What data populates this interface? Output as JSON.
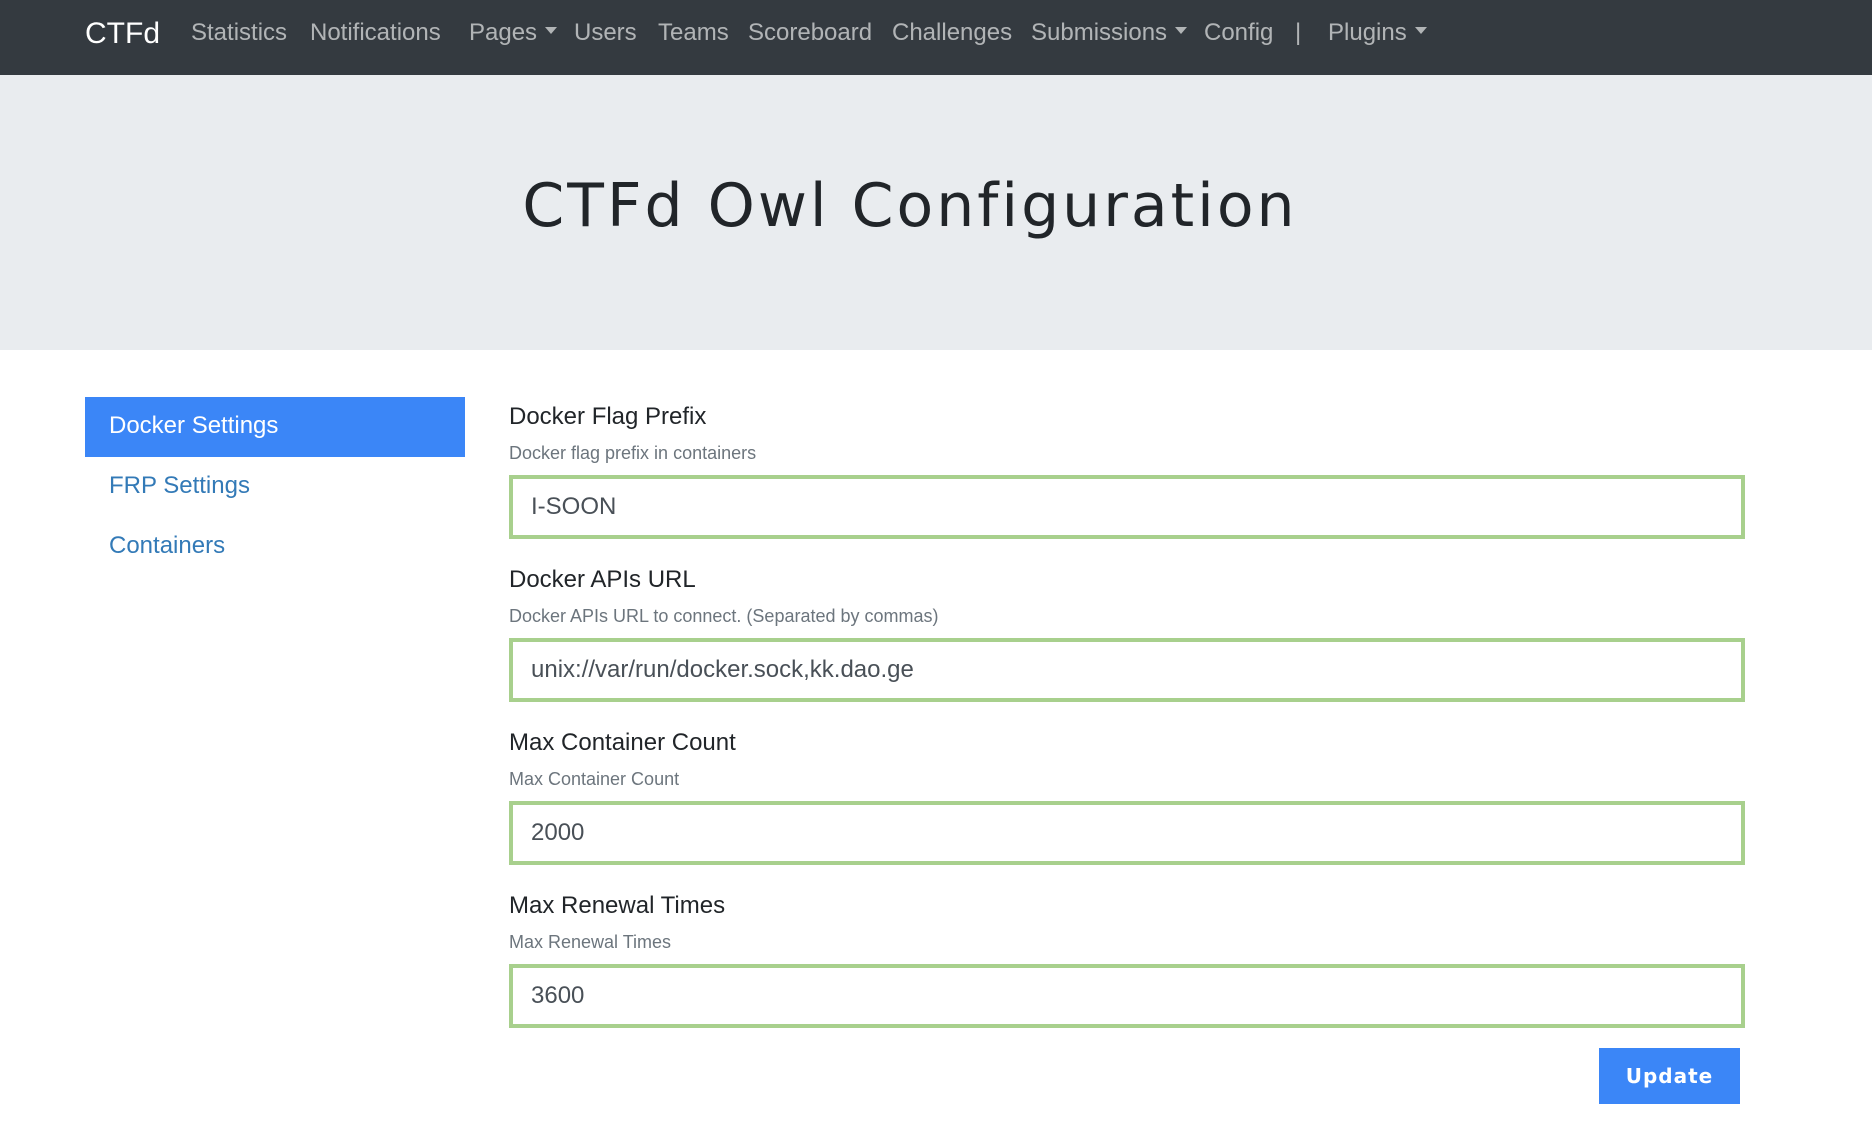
{
  "navbar": {
    "brand": "CTFd",
    "items": [
      {
        "label": "Statistics"
      },
      {
        "label": "Notifications"
      },
      {
        "label": "Pages"
      },
      {
        "label": "Users"
      },
      {
        "label": "Teams"
      },
      {
        "label": "Scoreboard"
      },
      {
        "label": "Challenges"
      },
      {
        "label": "Submissions"
      },
      {
        "label": "Config"
      },
      {
        "label": "Plugins"
      }
    ],
    "separator": "|"
  },
  "header": {
    "title": "CTFd Owl Configuration"
  },
  "sidebar": {
    "items": [
      {
        "label": "Docker Settings",
        "active": true
      },
      {
        "label": "FRP Settings",
        "active": false
      },
      {
        "label": "Containers",
        "active": false
      }
    ]
  },
  "form": {
    "fields": [
      {
        "label": "Docker Flag Prefix",
        "help": "Docker flag prefix in containers",
        "value": "I-SOON"
      },
      {
        "label": "Docker APIs URL",
        "help": "Docker APIs URL to connect. (Separated by commas)",
        "value": "unix://var/run/docker.sock,kk.dao.ge"
      },
      {
        "label": "Max Container Count",
        "help": "Max Container Count",
        "value": "2000"
      },
      {
        "label": "Max Renewal Times",
        "help": "Max Renewal Times",
        "value": "3600"
      }
    ],
    "submit_label": "Update"
  },
  "colors": {
    "navbar_bg": "#343a40",
    "jumbotron_bg": "#e9ecef",
    "accent": "#3b86f7",
    "link": "#337ab7",
    "input_border": "#a8d08d"
  }
}
